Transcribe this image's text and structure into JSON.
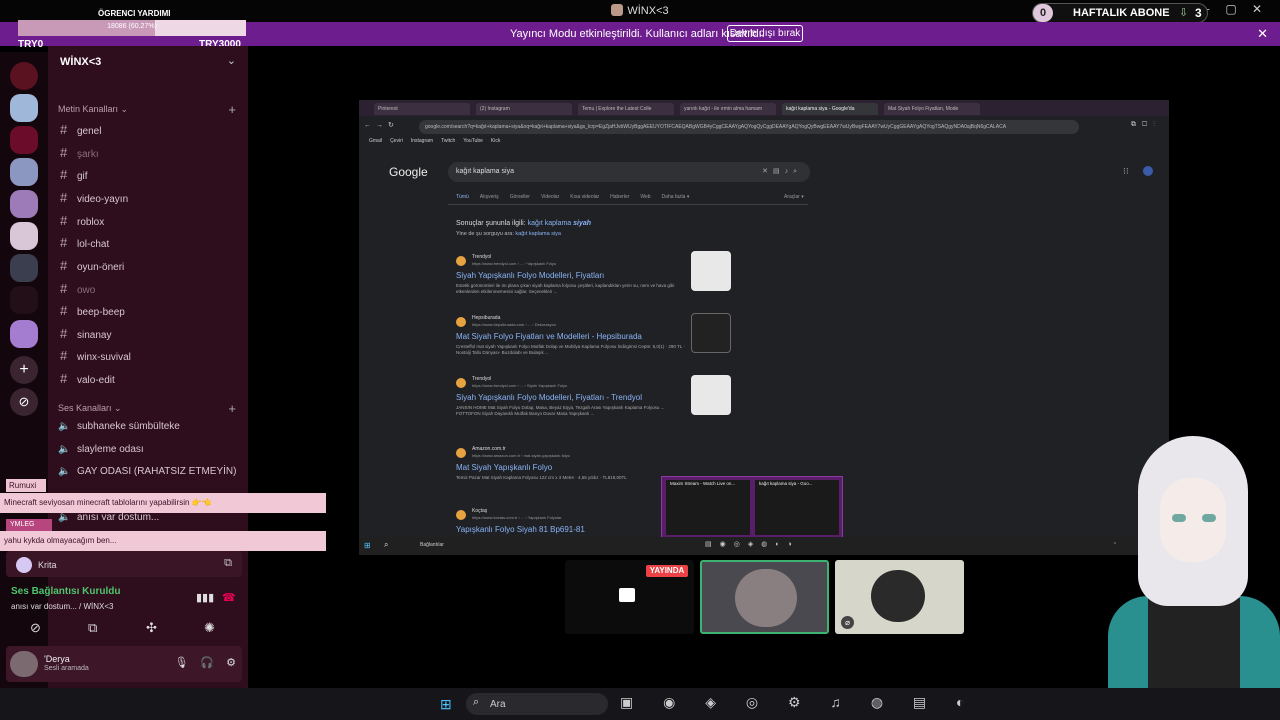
{
  "window": {
    "title": "WİNX<3",
    "minimize": "─",
    "maximize": "▢",
    "close": "✕"
  },
  "subscriber_goal": {
    "count_pill": "0",
    "label": "HAFTALIK ABONE",
    "arrow": "⇩",
    "count": "3"
  },
  "notice": {
    "text": "Yayıncı Modu etkinleştirildi. Kullanıcı adları kısaltıldı.",
    "button": "Devre dışı bırak",
    "close": "✕"
  },
  "donation_goal": {
    "title": "ÖGRENCI YARDIMI",
    "bar_text": "18086 (60.27%)",
    "progress_percent": 60.27,
    "min": "TRY0",
    "max": "TRY3000"
  },
  "server": {
    "name": "WİNX<3",
    "chevron": "⌄"
  },
  "text_category": {
    "label": "Metin Kanalları",
    "chevron": "⌄",
    "plus": "+"
  },
  "text_channels": [
    {
      "name": "genel",
      "hash": "#"
    },
    {
      "name": "şarkı",
      "hash": "#"
    },
    {
      "name": "gif",
      "hash": "#"
    },
    {
      "name": "video-yayın",
      "hash": "#"
    },
    {
      "name": "roblox",
      "hash": "#"
    },
    {
      "name": "lol-chat",
      "hash": "#"
    },
    {
      "name": "oyun-öneri",
      "hash": "#"
    },
    {
      "name": "owo",
      "hash": "#"
    },
    {
      "name": "beep-beep",
      "hash": "#"
    },
    {
      "name": "sinanay",
      "hash": "#"
    },
    {
      "name": "winx-suvival",
      "hash": "#"
    },
    {
      "name": "valo-edit",
      "hash": "#"
    }
  ],
  "voice_category": {
    "label": "Ses Kanalları",
    "chevron": "⌄",
    "plus": "+"
  },
  "voice_channels": [
    {
      "name": "subhaneke sümbülteke",
      "icon": "🔈"
    },
    {
      "name": "slayleme odası",
      "icon": "🔈"
    },
    {
      "name": "GAY ODASI (RAHATSIZ ETMEYİN)",
      "icon": "🔈"
    },
    {
      "name": "anısı var dostum...",
      "icon": "🔈"
    }
  ],
  "chat_overlay": [
    {
      "user": "Rumuxi",
      "message": "Minecraft seviyosan minecraft tablolarını yapabilirsin 👉👈"
    },
    {
      "user": "YMLEG",
      "message": "yahu kykda olmayacağım ben..."
    }
  ],
  "voice_member": {
    "name": "Krita"
  },
  "voice_connection": {
    "status": "Ses Bağlantısı Kuruldu",
    "channel": "anısı var dostum... / WİNX<3"
  },
  "user": {
    "name": "'Derya",
    "status": "Sesli aramada"
  },
  "browser": {
    "tabs": [
      "Pinterest",
      "(2) Instagram",
      "Temu | Explore the Latest Colle",
      "yarınlı kağıt - ile ırmin alma hamam",
      "kağıt kaplama siya - Google'da",
      "Mat Siyah Folyo Fiyatları, Mode"
    ],
    "url": "google.com/search?q=kağıt+kaplama+siya&oq=kağıt+kaplama+siya&gs_lcrp=EgZjaHJvbWUyBggAEEUYOTIFCAEQABgWGB4yCggCEAAYgAQYogQyCggDEAAYgAQYogQyBwgEEAAY7wUyBwgFEAAY7wUyCggGEAAYgAQYogTSAQgyNDA0ajBqN6gCALACA",
    "bookmarks": [
      "Gmail",
      "Çeviri",
      "Instagram",
      "Twitch",
      "YouTube",
      "Kick"
    ],
    "google_logo": "Google",
    "query": "kağıt kaplama siya",
    "search_tabs": [
      "Tümü",
      "Alışveriş",
      "Görseller",
      "Videolar",
      "Kısa videolar",
      "Haberler",
      "Web",
      "Daha fazla ▾"
    ],
    "tools": "Araçlar ▾",
    "suggest": {
      "prefix": "Sonuçlar şununla ilgili:",
      "corrected_plain": "kağıt kaplama",
      "corrected_bold": "siyah",
      "alt_prefix": "Yine de şu sorguyu ara:",
      "alt_query": "kağıt kaplama siya"
    },
    "results": [
      {
        "site": "Trendyol",
        "url": "https://www.trendyol.com › ... › Yapışkanlı Folyo",
        "title": "Siyah Yapışkanlı Folyo Modelleri, Fiyatları",
        "desc": "Estetik görünümleri ile ön plana çıkan siyah kaplama folyosu çeşitleri, kaplandıkları yerin su, nem ve hava gibi etkenlerden etkilenmemesini sağlar. Seçenekleri ..."
      },
      {
        "site": "Hepsiburada",
        "url": "https://www.hepsiburada.com › ... › Dekorasyon",
        "title": "Mat Siyah Folyo Fiyatları ve Modelleri - Hepsiburada",
        "desc": "Cresteffol mat siyah Yapışkanlı Folyo Mutfak Dolap ve Mobilya Kaplama Folyosu İndirgimsi Cepte: 5,0(1) · 290 TL · Nostalji Tallo Dünyası- Buzdolabı ve Bulaşık ..."
      },
      {
        "site": "Trendyol",
        "url": "https://www.trendyol.com › ... › Siyah Yapışkanlı Folyo",
        "title": "Siyah Yapışkanlı Folyo Modelleri, Fiyatları - Trendyol",
        "desc": "JANSIN HOME Mat Siyah Folyo Dolap, Masa, Beyaz Eşya, Tezgah Arası Yapışkanlı Kaplama Folyosu ... FOTTOFON Siyah Dayanıklı Mutfak Banyo Duvar Masa Yapışkanlı ..."
      },
      {
        "site": "Amazon.com.tr",
        "url": "https://www.amazon.com.tr › mat-siyah-yapışkanlı-folyo",
        "title": "Mat Siyah Yapışkanlı Folyo",
        "desc": "Temiz Pazar Mat Siyah Kaplama Folyosu 122 cm x 3 Metre · 4,65 yıldız · TL819,00TL"
      },
      {
        "site": "Koçtaş",
        "url": "https://www.koctas.com.tr › ... › Yapışkanlı Folyolar",
        "title": "Yapışkanlı Folyo Siyah 81 Bp691-81",
        "desc": ""
      }
    ],
    "alt_tab": [
      "Maxim Stream - Watch Live on...",
      "kağıt kaplama siya - Goo..."
    ],
    "taskbar_label": "Bağlantılar",
    "tray": "⌃"
  },
  "stream_tiles": {
    "live_badge": "YAYINDA",
    "mute_icon": "⌀"
  },
  "taskbar": {
    "start": "⊞",
    "search_icon": "⌕",
    "search_text": "Ara",
    "apps": "▣ ◉ ◈ ◎ ⚙ ♫ ◍ ▤ ◐"
  }
}
